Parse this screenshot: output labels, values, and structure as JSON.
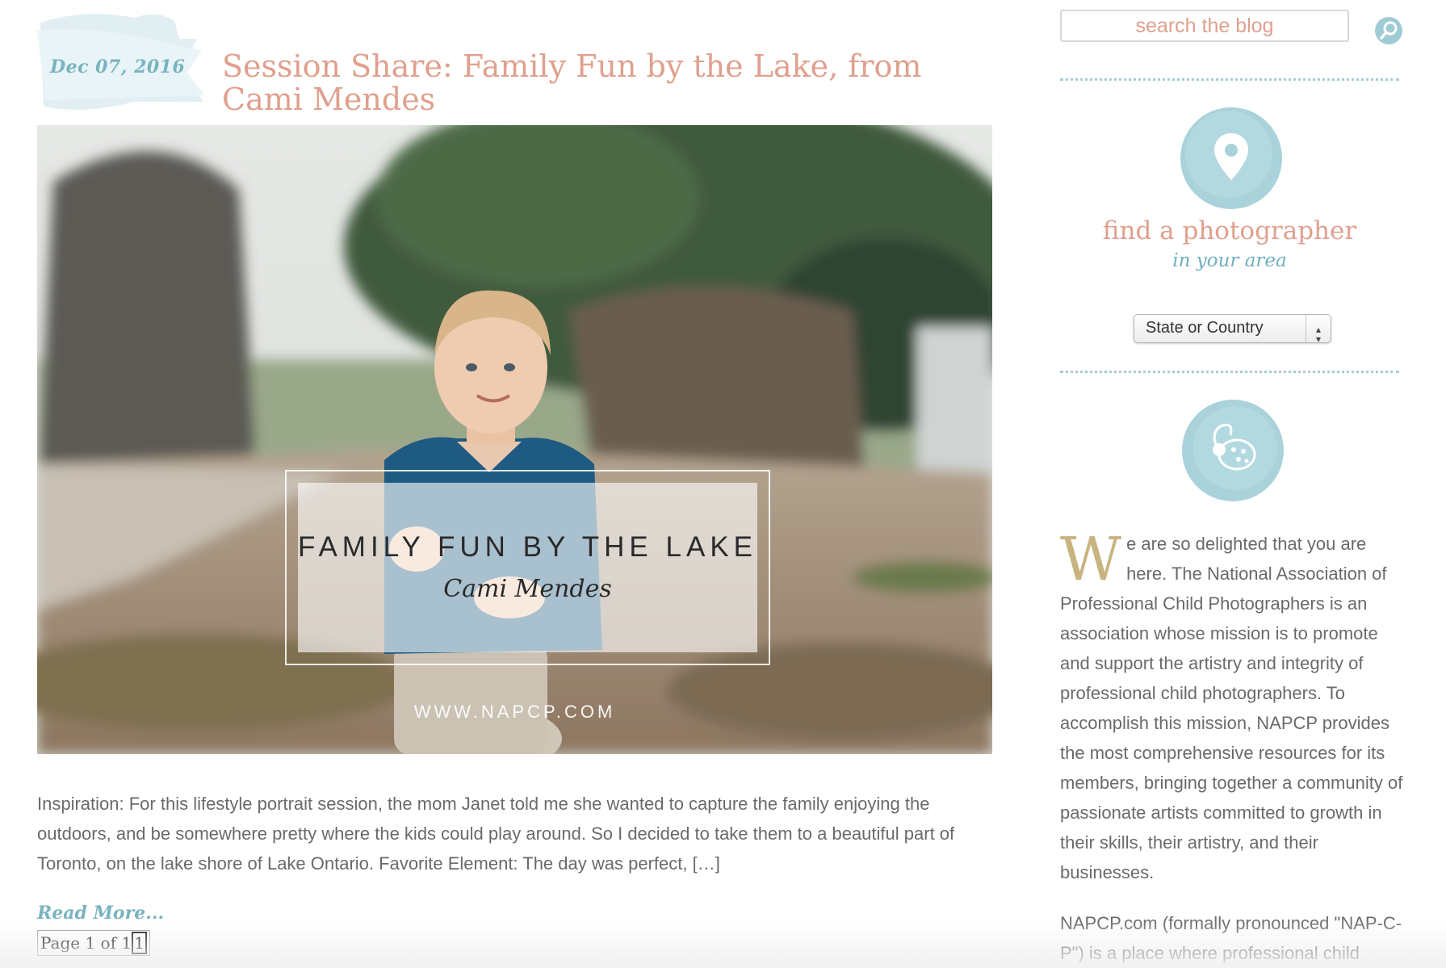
{
  "post": {
    "date": "Dec 07, 2016",
    "title": "Session Share: Family Fun by the Lake, from Cami Mendes",
    "hero": {
      "headline": "FAMILY FUN BY THE LAKE",
      "byline": "Cami Mendes",
      "url": "WWW.NAPCP.COM"
    },
    "excerpt": "Inspiration: For this lifestyle portrait session, the mom Janet told me she wanted to capture the family enjoying the outdoors, and be somewhere pretty where the kids could play around. So I decided to take them to a beautiful part of Toronto, on the lake shore of Lake Ontario. Favorite Element: The day was perfect, […]",
    "read_more": "Read More...",
    "pagination": {
      "prefix": "Page 1 of 1",
      "current": "1"
    }
  },
  "sidebar": {
    "search": {
      "placeholder": "search the blog",
      "icon": "search-icon"
    },
    "find": {
      "icon": "location-pin-icon",
      "title": "find a photographer",
      "subtitle": "in your area",
      "select_value": "State or Country"
    },
    "about": {
      "icon": "ladybug-icon",
      "dropcap": "W",
      "text": "e are so delighted that you are here. The National Association of Professional Child Photographers is an association whose mission is to promote and support the artistry and integrity of professional child photographers. To accomplish this mission, NAPCP provides the most comprehensive resources for its members, bringing together a community of passionate artists committed to growth in their skills, their artistry, and their businesses.",
      "text2": "NAPCP.com (formally pronounced \"NAP-C-P\") is a place where professional child"
    }
  },
  "colors": {
    "accent_teal": "#7ab3bf",
    "accent_coral": "#e0a08e",
    "dropcap_gold": "#c8b480"
  }
}
